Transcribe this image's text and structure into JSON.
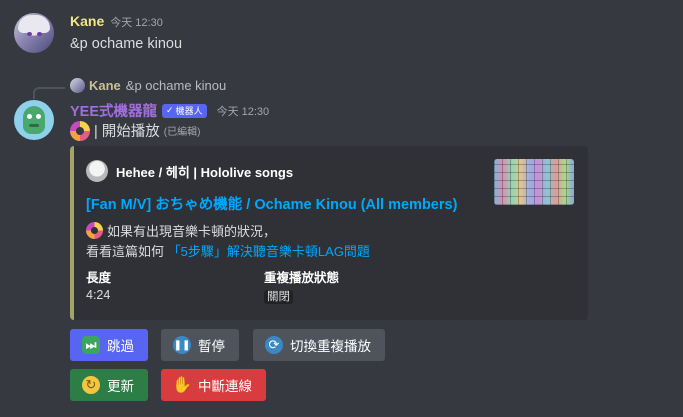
{
  "message1": {
    "username": "Kane",
    "timestamp": "今天 12:30",
    "content": "&p ochame kinou"
  },
  "reply": {
    "username": "Kane",
    "content": "&p ochame kinou"
  },
  "message2": {
    "username": "YEE式機器龍",
    "bot_tag": "機器人",
    "timestamp": "今天 12:30",
    "status": "| 開始播放",
    "edited": "(已編輯)"
  },
  "embed": {
    "color": "#a4a467",
    "author": "Hehee / 헤히 | Hololive songs",
    "title": "[Fan M/V] おちゃめ機能 / Ochame Kinou (All members)",
    "desc_line1": "如果有出現音樂卡頓的狀況，",
    "desc_line2_prefix": "看看這篇如何",
    "desc_link": "「5步驟」解決聽音樂卡頓LAG問題",
    "fields": [
      {
        "name": "長度",
        "value": "4:24"
      },
      {
        "name": "重複播放狀態",
        "value": "關閉"
      }
    ]
  },
  "buttons": {
    "skip": "跳過",
    "pause": "暫停",
    "loop": "切換重複播放",
    "refresh": "更新",
    "disconnect": "中斷連線"
  },
  "icons": {
    "skip": "skip-icon",
    "pause": "pause-icon",
    "loop": "loop-icon",
    "refresh": "refresh-icon",
    "disconnect": "wave-icon"
  }
}
